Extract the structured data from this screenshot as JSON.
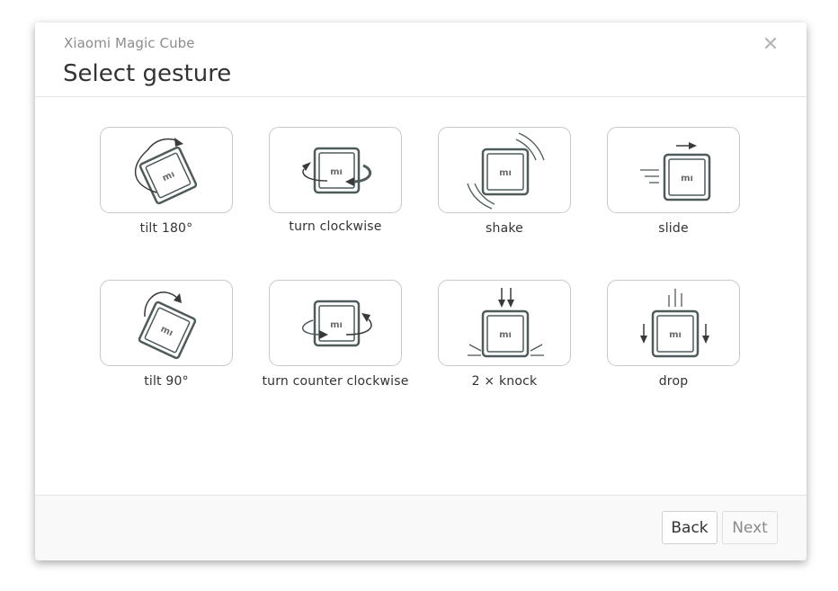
{
  "dialog": {
    "subtitle": "Xiaomi Magic Cube",
    "title": "Select gesture",
    "close_icon": "close-icon"
  },
  "gestures": [
    {
      "label": "tilt 180°",
      "icon": "tilt-180-icon"
    },
    {
      "label": "turn clockwise",
      "icon": "turn-clockwise-icon"
    },
    {
      "label": "shake",
      "icon": "shake-icon"
    },
    {
      "label": "slide",
      "icon": "slide-icon"
    },
    {
      "label": "tilt 90°",
      "icon": "tilt-90-icon"
    },
    {
      "label": "turn counter clockwise",
      "icon": "turn-counter-clockwise-icon"
    },
    {
      "label": "2 × knock",
      "icon": "knock-icon"
    },
    {
      "label": "drop",
      "icon": "drop-icon"
    }
  ],
  "footer": {
    "back_label": "Back",
    "next_label": "Next"
  },
  "colors": {
    "icon_stroke": "#4f5b5b",
    "arrow": "#3a3a3a"
  }
}
